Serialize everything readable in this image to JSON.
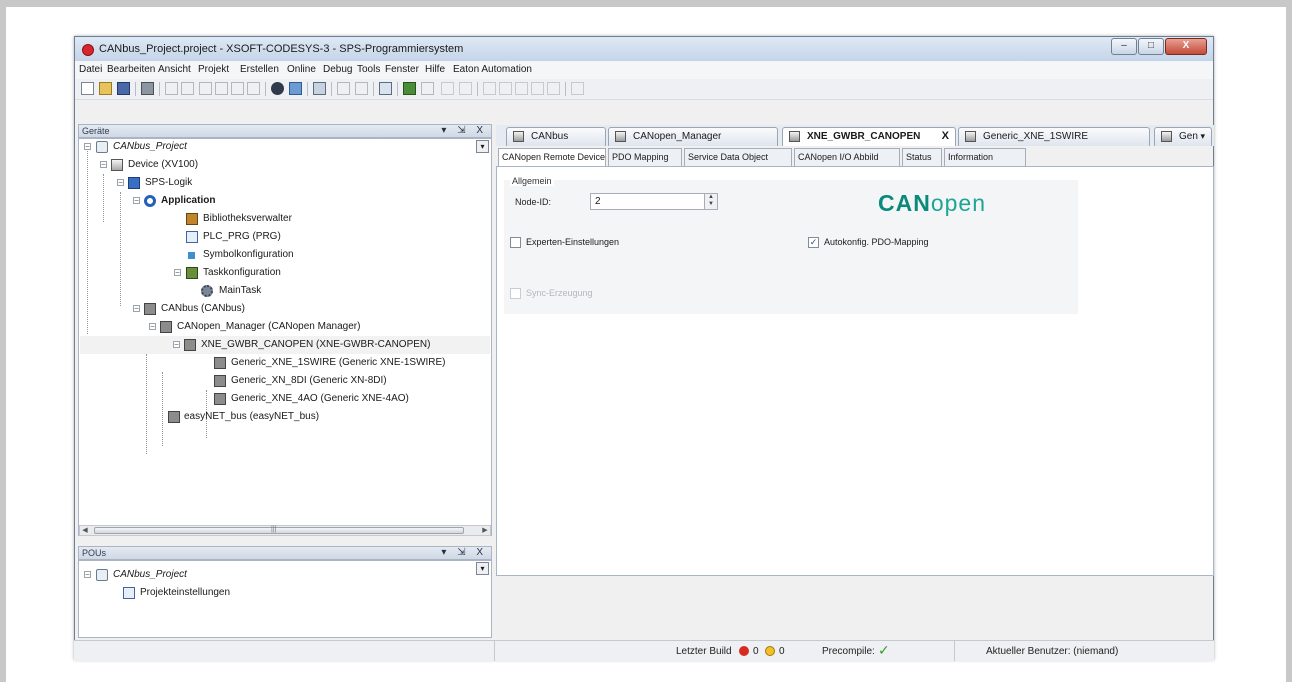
{
  "window": {
    "title": "CANbus_Project.project - XSOFT-CODESYS-3 - SPS-Programmiersystem",
    "controls": {
      "minimize": "–",
      "maximize": "□",
      "close": "X"
    }
  },
  "menu": [
    "Datei",
    "Bearbeiten",
    "Ansicht",
    "Projekt",
    "Erstellen",
    "Online",
    "Debug",
    "Tools",
    "Fenster",
    "Hilfe",
    "Eaton Automation"
  ],
  "devices_panel": {
    "title": "Geräte",
    "controls": "▾ ⇲ X",
    "tree": [
      {
        "label": "CANbus_Project",
        "icon": "project-icon"
      },
      {
        "label": "Device (XV100)",
        "icon": "device-icon"
      },
      {
        "label": "SPS-Logik",
        "icon": "plc-logic-icon"
      },
      {
        "label": "Application",
        "icon": "application-icon"
      },
      {
        "label": "Bibliotheksverwalter",
        "icon": "library-icon"
      },
      {
        "label": "PLC_PRG (PRG)",
        "icon": "program-icon"
      },
      {
        "label": "Symbolkonfiguration",
        "icon": "symbol-config-icon"
      },
      {
        "label": "Taskkonfiguration",
        "icon": "task-config-icon"
      },
      {
        "label": "MainTask",
        "icon": "gear-icon"
      },
      {
        "label": "CANbus (CANbus)",
        "icon": "bus-icon"
      },
      {
        "label": "CANopen_Manager (CANopen Manager)",
        "icon": "bus-icon"
      },
      {
        "label": "XNE_GWBR_CANOPEN (XNE-GWBR-CANOPEN)",
        "icon": "bus-icon"
      },
      {
        "label": "Generic_XNE_1SWIRE (Generic XNE-1SWIRE)",
        "icon": "bus-icon"
      },
      {
        "label": "Generic_XN_8DI (Generic XN-8DI)",
        "icon": "bus-icon"
      },
      {
        "label": "Generic_XNE_4AO (Generic XNE-4AO)",
        "icon": "bus-icon"
      },
      {
        "label": "easyNET_bus (easyNET_bus)",
        "icon": "bus-icon"
      }
    ],
    "scroll_grip": "|||"
  },
  "pous_panel": {
    "title": "POUs",
    "controls": "▾ ⇲ X",
    "tree": [
      {
        "label": "CANbus_Project",
        "icon": "project-icon"
      },
      {
        "label": "Projekteinstellungen",
        "icon": "settings-icon"
      }
    ]
  },
  "doc_tabs": [
    {
      "label": "CANbus"
    },
    {
      "label": "CANopen_Manager"
    },
    {
      "label": "XNE_GWBR_CANOPEN",
      "active": true,
      "close": "X"
    },
    {
      "label": "Generic_XNE_1SWIRE"
    },
    {
      "label": "Gen"
    }
  ],
  "doc_tabs_dropdown": "▾",
  "sub_tabs": [
    "CANopen Remote Device",
    "PDO Mapping",
    "Service Data Object",
    "CANopen I/O Abbild",
    "Status",
    "Information"
  ],
  "editor": {
    "group_title": "Allgemein",
    "node_id_label": "Node-ID:",
    "node_id_value": "2",
    "expert_settings": {
      "label": "Experten-Einstellungen",
      "checked": false
    },
    "autoconfig_pdo": {
      "label": "Autokonfig. PDO-Mapping",
      "checked": true
    },
    "sync_generation": {
      "label": "Sync-Erzeugung",
      "checked": false,
      "disabled": true
    },
    "logo": {
      "bold": "CAN",
      "light": "open"
    }
  },
  "status": {
    "last_build_label": "Letzter Build",
    "errors": "0",
    "warnings": "0",
    "precompile_label": "Precompile:",
    "user_label": "Aktueller Benutzer: (niemand)"
  },
  "colors": {
    "accent": "#0a8a7c",
    "error": "#d72b22",
    "warning": "#f3c02b",
    "ok": "#3a9a2a"
  }
}
